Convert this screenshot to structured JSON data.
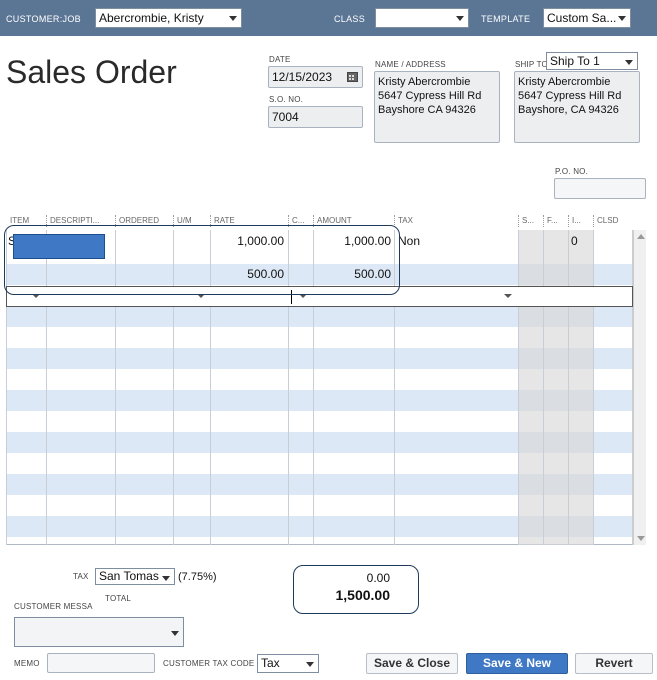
{
  "header": {
    "customer_job_label": "CUSTOMER:JOB",
    "customer_job_value": "Abercrombie, Kristy",
    "class_label": "CLASS",
    "class_value": "",
    "template_label": "TEMPLATE",
    "template_value": "Custom Sa..."
  },
  "form": {
    "title": "Sales Order",
    "date_label": "DATE",
    "date_value": "12/15/2023",
    "so_no_label": "S.O. NO.",
    "so_no_value": "7004",
    "name_address_label": "NAME / ADDRESS",
    "name_address_value": "Kristy Abercrombie\n5647 Cypress Hill Rd\nBayshore CA 94326",
    "ship_to_label": "SHIP TO",
    "ship_to_value": "Ship To 1",
    "ship_to_address": "Kristy Abercrombie\n5647 Cypress Hill Rd\nBayshore, CA 94326",
    "po_no_label": "P.O. NO.",
    "po_no_value": ""
  },
  "table": {
    "columns": [
      "ITEM",
      "DESCRIPTI...",
      "ORDERED",
      "U/M",
      "RATE",
      "C...",
      "AMOUNT",
      "TAX",
      "S...",
      "F...",
      "I...",
      "CLSD"
    ],
    "rows": [
      {
        "item": "S",
        "rate": "1,000.00",
        "amount": "1,000.00",
        "tax": "Non",
        "invoiced": "0"
      },
      {
        "item": "",
        "rate": "500.00",
        "amount": "500.00",
        "tax": "",
        "invoiced": ""
      }
    ]
  },
  "footer": {
    "tax_label": "TAX",
    "tax_value": "San Tomas",
    "tax_rate": "(7.75%)",
    "tax_amount": "0.00",
    "total_label": "TOTAL",
    "total_value": "1,500.00",
    "customer_message_label": "CUSTOMER MESSA",
    "memo_label": "MEMO",
    "customer_tax_code_label": "CUSTOMER TAX CODE",
    "customer_tax_code_value": "Tax"
  },
  "buttons": {
    "save_close": "Save & Close",
    "save_new": "Save & New",
    "revert": "Revert"
  },
  "colors": {
    "header_bar": "#5b7595",
    "row_stripe": "#dce8f5",
    "selection": "#3f78c5",
    "callout_border": "#1f3b5c"
  }
}
